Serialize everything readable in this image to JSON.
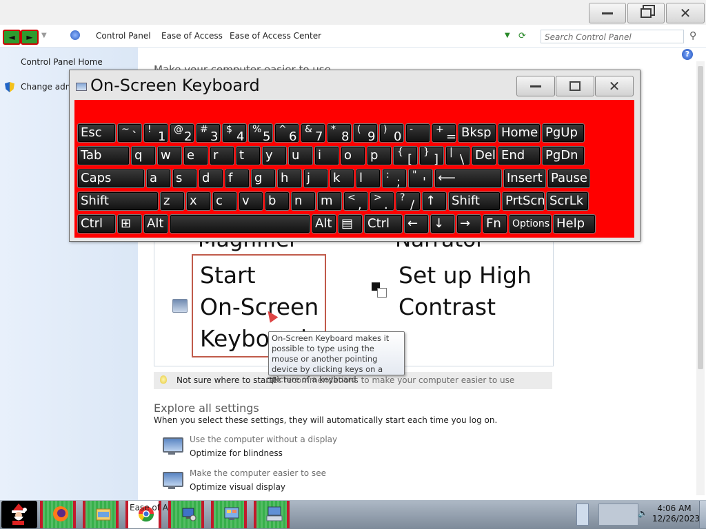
{
  "window": {
    "minimize_icon": "minimize-icon",
    "maximize_icon": "restore-icon",
    "close_icon": "close-icon"
  },
  "address": {
    "back_glyph": "◄",
    "forward_glyph": "►",
    "breadcrumbs": [
      "Control Panel",
      "Ease of Access",
      "Ease of Access Center"
    ],
    "search_placeholder": "Search Control Panel"
  },
  "sidebar": {
    "home": "Control Panel Home",
    "change_admin": "Change admi"
  },
  "content": {
    "heading": "Make your computer easier to use",
    "magnifier_partial": "Magnifier",
    "narrator_partial": "Narrator",
    "start_osk": [
      "Start",
      "On-Screen",
      "Keyboard"
    ],
    "high_contrast": [
      "Set up High",
      "Contrast"
    ],
    "tooltip": "On-Screen Keyboard makes it possible to type using the mouse or another pointing device by clicking keys on a picture of a keyboard.",
    "tip_question": "Not sure where to start?",
    "tip_link": "Get recommendations to make your computer easier to use",
    "explore_title": "Explore all settings",
    "explore_subtitle": "When you select these settings, they will automatically start each time you log on.",
    "settings": [
      {
        "desc": "Use the computer without a display",
        "name": "Optimize for blindness",
        "icon": "monitor-speech-icon"
      },
      {
        "desc": "Make the computer easier to see",
        "name": "Optimize visual display",
        "icon": "monitor-magnify-icon"
      }
    ]
  },
  "osk": {
    "title": "On-Screen Keyboard",
    "background_color": "#ff0000",
    "rows": [
      [
        {
          "label": "Esc"
        },
        {
          "shift": "~",
          "main": "`"
        },
        {
          "shift": "!",
          "main": "1"
        },
        {
          "shift": "@",
          "main": "2"
        },
        {
          "shift": "#",
          "main": "3"
        },
        {
          "shift": "$",
          "main": "4"
        },
        {
          "shift": "%",
          "main": "5"
        },
        {
          "shift": "^",
          "main": "6"
        },
        {
          "shift": "&",
          "main": "7"
        },
        {
          "shift": "*",
          "main": "8"
        },
        {
          "shift": "(",
          "main": "9"
        },
        {
          "shift": ")",
          "main": "0"
        },
        {
          "shift": "-",
          "main": "_"
        },
        {
          "shift": "+",
          "main": "="
        },
        {
          "label": "Bksp"
        },
        {
          "label": "Home"
        },
        {
          "label": "PgUp"
        }
      ],
      [
        {
          "label": "Tab"
        },
        {
          "label": "q"
        },
        {
          "label": "w"
        },
        {
          "label": "e"
        },
        {
          "label": "r"
        },
        {
          "label": "t"
        },
        {
          "label": "y"
        },
        {
          "label": "u"
        },
        {
          "label": "i"
        },
        {
          "label": "o"
        },
        {
          "label": "p"
        },
        {
          "shift": "{",
          "main": "["
        },
        {
          "shift": "}",
          "main": "]"
        },
        {
          "shift": "|",
          "main": "\\"
        },
        {
          "label": "Del"
        },
        {
          "label": "End"
        },
        {
          "label": "PgDn"
        }
      ],
      [
        {
          "label": "Caps"
        },
        {
          "label": "a"
        },
        {
          "label": "s"
        },
        {
          "label": "d"
        },
        {
          "label": "f"
        },
        {
          "label": "g"
        },
        {
          "label": "h"
        },
        {
          "label": "j"
        },
        {
          "label": "k"
        },
        {
          "label": "l"
        },
        {
          "shift": ":",
          "main": ";"
        },
        {
          "shift": "\"",
          "main": "'"
        },
        {
          "label": "⟵"
        },
        {
          "label": "Insert"
        },
        {
          "label": "Pause"
        }
      ],
      [
        {
          "label": "Shift"
        },
        {
          "label": "z"
        },
        {
          "label": "x"
        },
        {
          "label": "c"
        },
        {
          "label": "v"
        },
        {
          "label": "b"
        },
        {
          "label": "n"
        },
        {
          "label": "m"
        },
        {
          "shift": "<",
          "main": ","
        },
        {
          "shift": ">",
          "main": "."
        },
        {
          "shift": "?",
          "main": "/"
        },
        {
          "label": "↑"
        },
        {
          "label": "Shift"
        },
        {
          "label": "PrtScn"
        },
        {
          "label": "ScrLk"
        }
      ],
      [
        {
          "label": "Ctrl"
        },
        {
          "label": "⊞"
        },
        {
          "label": "Alt"
        },
        {
          "label": ""
        },
        {
          "label": "Alt"
        },
        {
          "label": "▤"
        },
        {
          "label": "Ctrl"
        },
        {
          "label": "←"
        },
        {
          "label": "↓"
        },
        {
          "label": "→"
        },
        {
          "label": "Fn"
        },
        {
          "label": "Options"
        },
        {
          "label": "Help"
        }
      ]
    ]
  },
  "taskbar": {
    "chrome_partial": "Ease of Ac",
    "time": "4:06 AM",
    "date": "12/26/2023",
    "apps": [
      "firefox-icon",
      "file-explorer-icon",
      "chrome-icon",
      "network-icon",
      "control-panel-icon",
      "on-screen-keyboard-icon"
    ]
  }
}
